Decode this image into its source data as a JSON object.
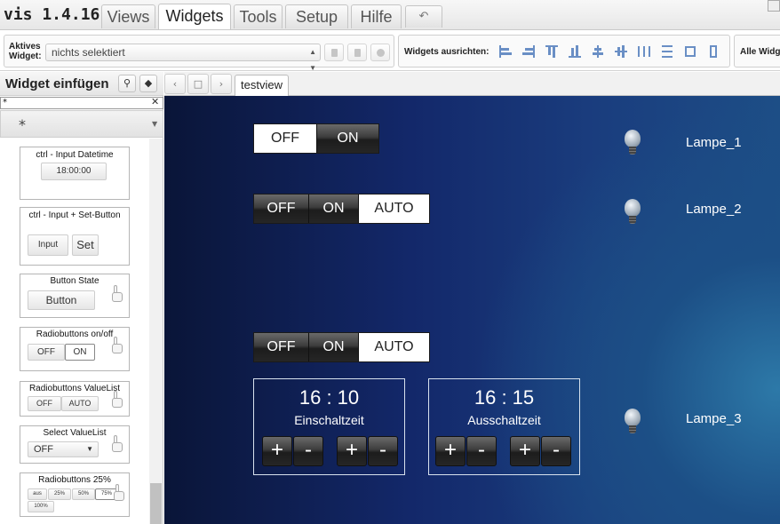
{
  "app": {
    "title": "vis 1.4.16"
  },
  "menu": {
    "tabs": [
      {
        "label": "Views"
      },
      {
        "label": "Widgets"
      },
      {
        "label": "Tools"
      },
      {
        "label": "Setup"
      },
      {
        "label": "Hilfe"
      }
    ],
    "active_tab": "Widgets",
    "undo_icon": "undo-arrow-icon"
  },
  "toolbar": {
    "active_widget_label": "Aktives\nWidget:",
    "active_widget_value": "nichts selektiert",
    "align_label": "Widgets ausrichten:",
    "all_label": "Alle Widg"
  },
  "left_panel": {
    "title": "Widget einfügen",
    "filter_value": "*",
    "set_value": "*",
    "widgets": [
      {
        "title": "ctrl - Input Datetime",
        "sample": "18:00:00"
      },
      {
        "title": "ctrl - Input + Set-Button",
        "input": "Input",
        "set": "Set"
      },
      {
        "title": "Button State",
        "button": "Button"
      },
      {
        "title": "Radiobuttons on/off",
        "off": "OFF",
        "on": "ON"
      },
      {
        "title": "Radiobuttons ValueList",
        "off": "OFF",
        "auto": "AUTO"
      },
      {
        "title": "Select ValueList",
        "value": "OFF"
      },
      {
        "title": "Radiobuttons 25%",
        "options": [
          "aus",
          "25%",
          "50%",
          "75%",
          "100%"
        ]
      }
    ]
  },
  "views": {
    "active": "testview"
  },
  "canvas": {
    "switch1": {
      "off": "OFF",
      "on": "ON"
    },
    "switch2": {
      "off": "OFF",
      "on": "ON",
      "auto": "AUTO"
    },
    "switch3": {
      "off": "OFF",
      "on": "ON",
      "auto": "AUTO"
    },
    "lamps": [
      "Lampe_1",
      "Lampe_2",
      "Lampe_3"
    ],
    "timers": [
      {
        "time": "16 : 10",
        "label": "Einschaltzeit"
      },
      {
        "time": "16 : 15",
        "label": "Ausschaltzeit"
      }
    ],
    "plus": "+",
    "minus": "-"
  },
  "colors": {
    "canvas_dark": "#0a1538",
    "canvas_light": "#2d79a8",
    "active_segment": "#ffffff"
  }
}
